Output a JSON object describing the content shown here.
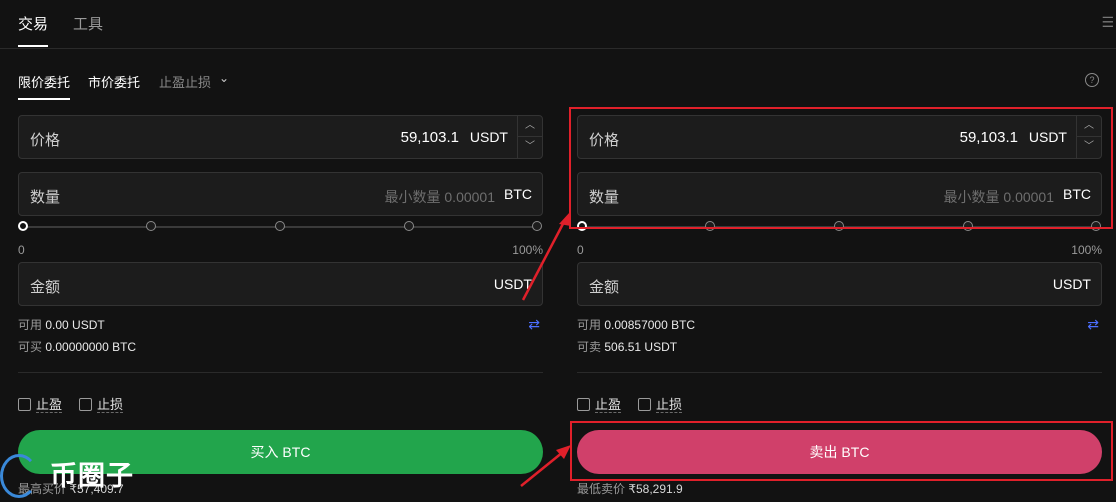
{
  "top_tabs": [
    "交易",
    "工具"
  ],
  "order_tabs": {
    "limit": "限价委托",
    "market": "市价委托",
    "tpsl": "止盈止损"
  },
  "help_icon": "?",
  "buy": {
    "price_label": "价格",
    "price_value": "59,103.1",
    "price_unit": "USDT",
    "amount_label": "数量",
    "amount_placeholder": "最小数量 0.00001",
    "amount_unit": "BTC",
    "slider_min": "0",
    "slider_max": "100%",
    "slider_position_pct": 0,
    "total_label": "金额",
    "total_unit": "USDT",
    "avail_label": "可用",
    "avail_value": "0.00 USDT",
    "can_label": "可买",
    "can_value": "0.00000000 BTC",
    "tp_label": "止盈",
    "sl_label": "止损",
    "button_label": "买入 BTC",
    "footer_label": "最高买价",
    "footer_value": "₹57,409.7"
  },
  "sell": {
    "price_label": "价格",
    "price_value": "59,103.1",
    "price_unit": "USDT",
    "amount_label": "数量",
    "amount_placeholder": "最小数量 0.00001",
    "amount_unit": "BTC",
    "slider_min": "0",
    "slider_max": "100%",
    "slider_position_pct": 0,
    "total_label": "金额",
    "total_unit": "USDT",
    "avail_label": "可用",
    "avail_value": "0.00857000 BTC",
    "can_label": "可卖",
    "can_value": "506.51 USDT",
    "tp_label": "止盈",
    "sl_label": "止损",
    "button_label": "卖出 BTC",
    "footer_label": "最低卖价",
    "footer_value": "₹58,291.9"
  },
  "watermark": "币圈子",
  "colors": {
    "buy": "#22a54c",
    "sell": "#d0406a",
    "highlight": "#e0202a",
    "swap": "#4c6fff"
  }
}
